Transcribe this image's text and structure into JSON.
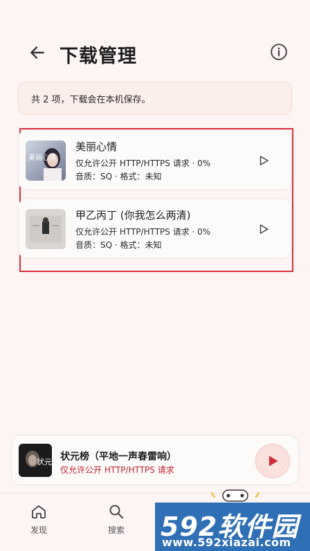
{
  "header": {
    "title": "下载管理",
    "back_icon": "arrow-left-icon",
    "info_icon": "info-icon"
  },
  "notice": {
    "text": "共 2 项，下载会在本机保存。"
  },
  "downloads": [
    {
      "title": "美丽心情",
      "status": "仅允许公开 HTTP/HTTPS 请求 · 0%",
      "meta": "音质：SQ · 格式：未知",
      "cover_text": "美丽心情"
    },
    {
      "title": "甲乙丙丁 (你我怎么两清)",
      "status": "仅允许公开 HTTP/HTTPS 请求 · 0%",
      "meta": "音质：SQ · 格式：未知"
    }
  ],
  "player": {
    "title": "状元榜（平地一声春雷响）",
    "status": "仅允许公开 HTTP/HTTPS 请求",
    "cover_text": "状元榜"
  },
  "nav": {
    "home_label": "发现",
    "search_label": "搜索"
  },
  "watermark": {
    "brand": "592软件园",
    "url": "www.592xiazai.com"
  },
  "colors": {
    "background": "#fdf5f3",
    "accent": "#c0202c",
    "highlight_border": "#d6303c",
    "watermark_blue": "#2f6fb5"
  }
}
